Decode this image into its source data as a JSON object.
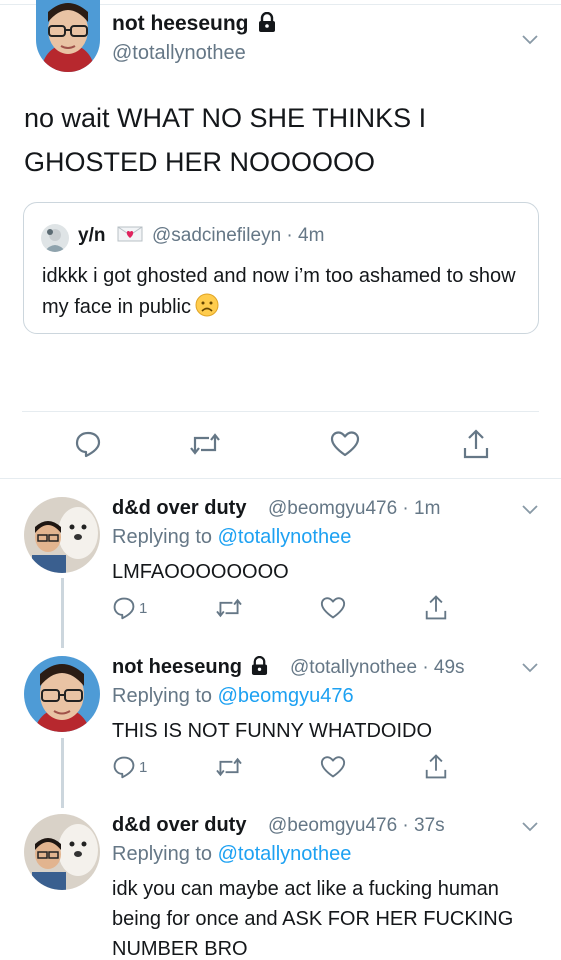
{
  "main_tweet": {
    "name": "not heeseung",
    "handle": "@totallynothee",
    "text": "no wait WHAT NO SHE THINKS I GHOSTED HER NOOOOOO",
    "quote": {
      "name": "y/n",
      "handle_time": "@sadcinefileyn · 4m",
      "text": "idkkk i got ghosted and now i’m too ashamed to show my face in public"
    },
    "actions": [
      "reply-icon",
      "retweet-icon",
      "like-icon",
      "share-icon"
    ]
  },
  "replies": [
    {
      "name": "d&d over duty",
      "handle_time": "@beomgyu476 · 1m",
      "replying_prefix": "Replying to",
      "replying_to": "@totallynothee",
      "text": "LMFAOOOOOOOO",
      "reply_count": "1"
    },
    {
      "name": "not heeseung",
      "handle_time": "@totallynothee · 49s",
      "replying_prefix": "Replying to",
      "replying_to": "@beomgyu476",
      "text": "THIS IS NOT FUNNY WHATDOIDO",
      "reply_count": "1"
    },
    {
      "name": "d&d over duty",
      "handle_time": "@beomgyu476 · 37s",
      "replying_prefix": "Replying to",
      "replying_to": "@totallynothee",
      "text": "idk you can maybe act like a fucking human being for once and ASK FOR HER FUCKING NUMBER BRO"
    }
  ],
  "colors": {
    "text": "#14171a",
    "secondary": "#657786",
    "link": "#1da1f2",
    "border": "#e6ecf0"
  }
}
